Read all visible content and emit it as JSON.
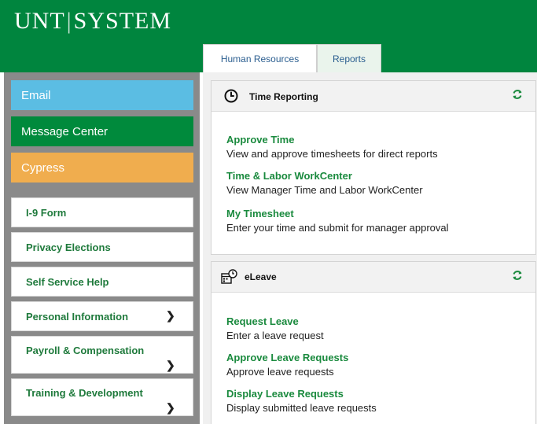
{
  "header": {
    "logo_left": "UNT",
    "logo_sep": "|",
    "logo_right": "SYSTEM",
    "tabs": [
      {
        "label": "Human Resources"
      },
      {
        "label": "Reports"
      }
    ]
  },
  "sidebar": {
    "colored_items": [
      {
        "label": "Email",
        "color": "#5bbde3"
      },
      {
        "label": "Message Center",
        "color": "#008a3c"
      },
      {
        "label": "Cypress",
        "color": "#f0ad4e"
      }
    ],
    "items": [
      {
        "label": "I-9 Form"
      },
      {
        "label": "Privacy Elections"
      },
      {
        "label": "Self Service Help"
      },
      {
        "label": "Personal Information"
      },
      {
        "label": "Payroll & Compensation"
      },
      {
        "label": "Training & Development"
      }
    ]
  },
  "time_reporting": {
    "title": "Time Reporting",
    "links": [
      {
        "label": "Approve Time",
        "desc": "View and approve timesheets for direct reports"
      },
      {
        "label": "Time & Labor WorkCenter",
        "desc": "View Manager Time and Labor WorkCenter"
      },
      {
        "label": "My Timesheet",
        "desc": "Enter your time and submit for manager approval"
      }
    ]
  },
  "eleave": {
    "title": "eLeave",
    "links": [
      {
        "label": "Request Leave",
        "desc": "Enter a leave request"
      },
      {
        "label": "Approve Leave Requests",
        "desc": "Approve leave requests"
      },
      {
        "label": "Display Leave Requests",
        "desc": "Display submitted leave requests"
      }
    ]
  },
  "colors": {
    "brand_green": "#00853e",
    "link_green": "#1a8a3e"
  }
}
